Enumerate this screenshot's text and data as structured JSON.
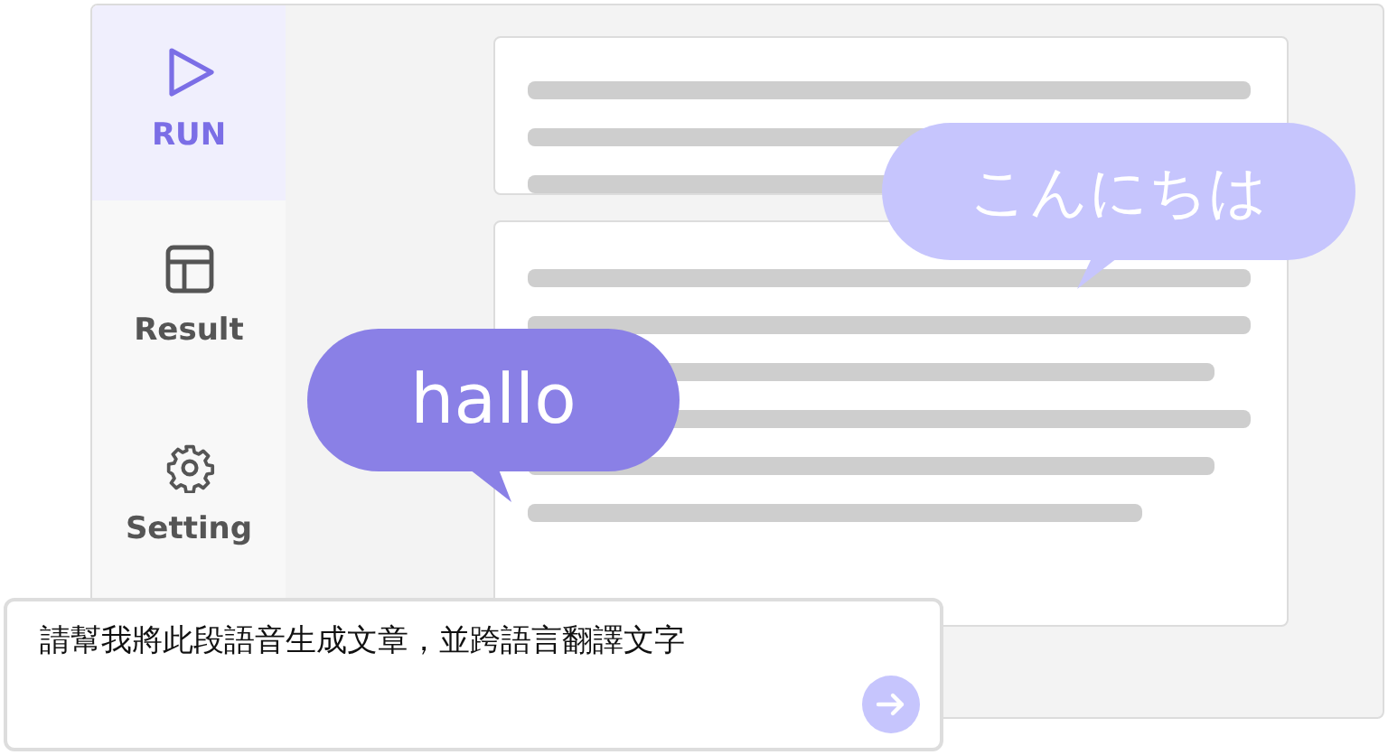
{
  "sidebar": {
    "items": [
      {
        "label": "RUN",
        "kind": "play",
        "selected": true
      },
      {
        "label": "Result",
        "kind": "table",
        "selected": false
      },
      {
        "label": "Setting",
        "kind": "gear",
        "selected": false
      }
    ]
  },
  "bubbles": [
    {
      "text": "こんにちは",
      "color": "#c6c5fd"
    },
    {
      "text": "hallo",
      "color": "#8a80e6"
    }
  ],
  "prompt": {
    "value": "請幫我將此段語音生成文章，並跨語言翻譯文字"
  }
}
